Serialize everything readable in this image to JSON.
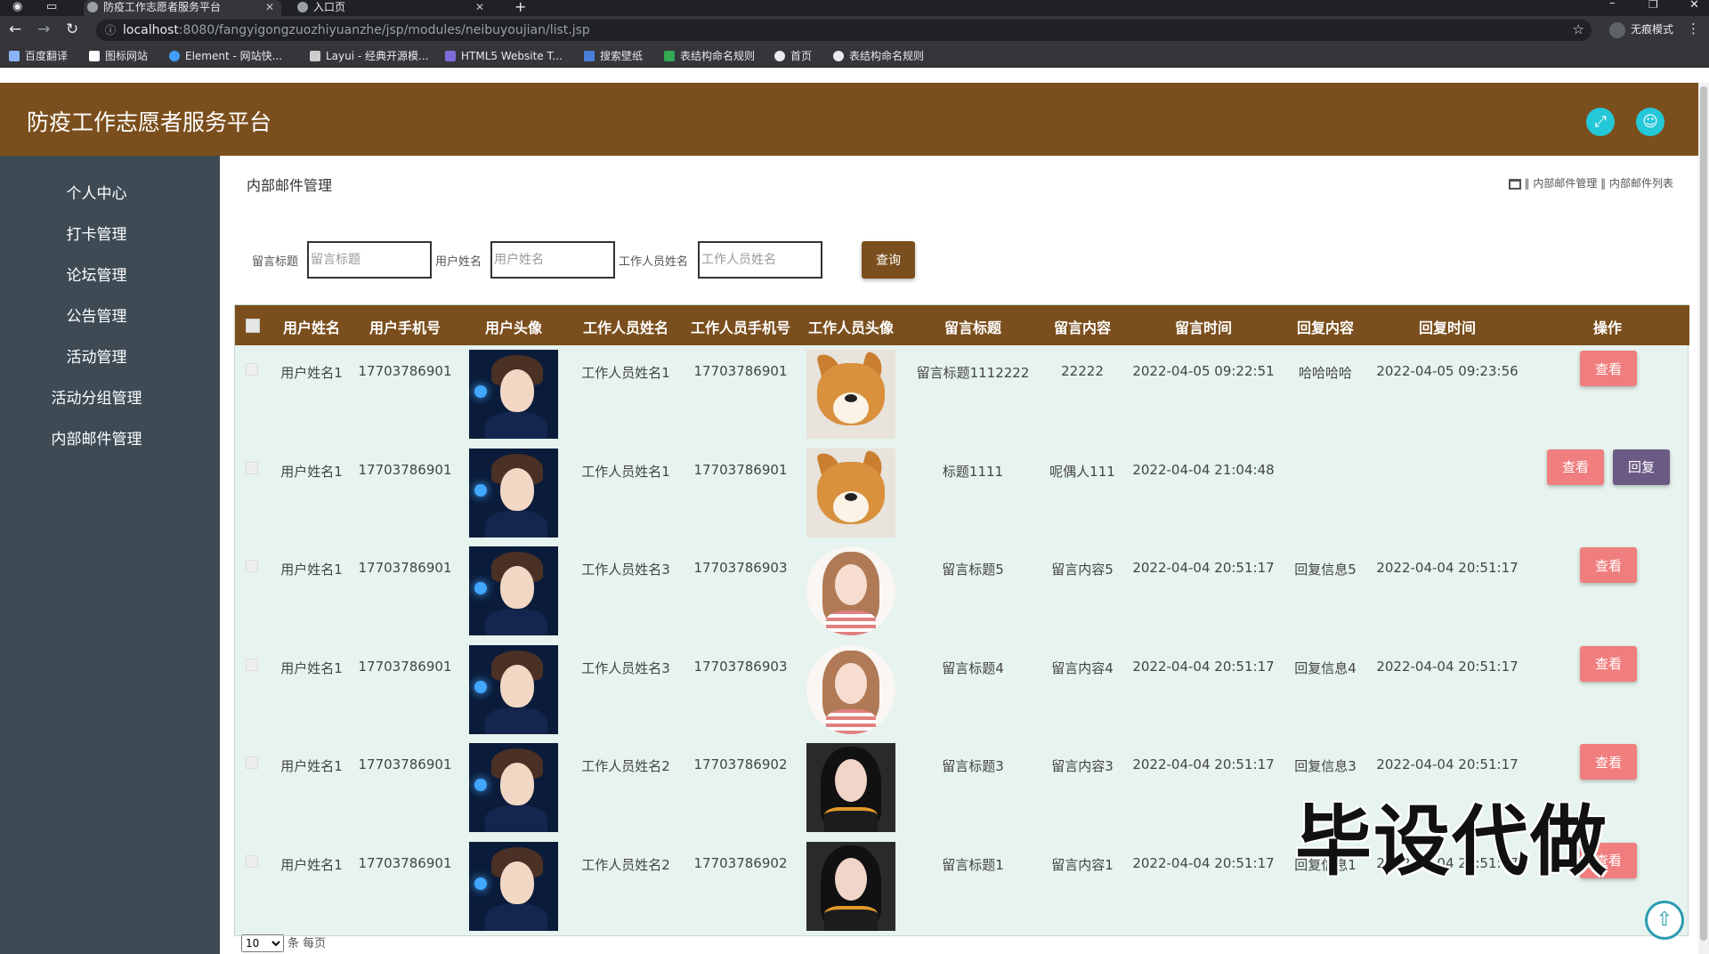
{
  "browser": {
    "tabs": [
      {
        "title": "防疫工作志愿者服务平台",
        "active": true
      },
      {
        "title": "入口页",
        "active": false
      }
    ],
    "url_host": "localhost",
    "url_path": ":8080/fangyigongzuozhiyuanzhe/jsp/modules/neibuyoujian/list.jsp",
    "incognito_label": "无痕模式",
    "bookmarks": [
      "百度翻译",
      "图标网站",
      "Element - 网站快...",
      "Layui - 经典开源模...",
      "HTML5 Website T...",
      "搜索壁纸",
      "表结构命名规则",
      "首页",
      "表结构命名规则"
    ]
  },
  "header": {
    "title": "防疫工作志愿者服务平台"
  },
  "sidebar": {
    "items": [
      "个人中心",
      "打卡管理",
      "论坛管理",
      "公告管理",
      "活动管理",
      "活动分组管理",
      "内部邮件管理"
    ]
  },
  "page": {
    "title": "内部邮件管理",
    "breadcrumb": "‖ 内部邮件管理 ‖ 内部邮件列表"
  },
  "search": {
    "fields": [
      {
        "label": "留言标题",
        "placeholder": "留言标题"
      },
      {
        "label": "用户姓名",
        "placeholder": "用户姓名"
      },
      {
        "label": "工作人员姓名",
        "placeholder": "工作人员姓名"
      }
    ],
    "button": "查询"
  },
  "table": {
    "columns": [
      "用户姓名",
      "用户手机号",
      "用户头像",
      "工作人员姓名",
      "工作人员手机号",
      "工作人员头像",
      "留言标题",
      "留言内容",
      "留言时间",
      "回复内容",
      "回复时间",
      "操作"
    ],
    "rows": [
      {
        "user_name": "用户姓名1",
        "user_phone": "17703786901",
        "staff_name": "工作人员姓名1",
        "staff_phone": "17703786901",
        "staff_avatar": "dog",
        "title": "留言标题1112222",
        "content": "22222",
        "time": "2022-04-05 09:22:51",
        "reply": "哈哈哈哈",
        "reply_time": "2022-04-05 09:23:56",
        "view": "查看"
      },
      {
        "user_name": "用户姓名1",
        "user_phone": "17703786901",
        "staff_name": "工作人员姓名1",
        "staff_phone": "17703786901",
        "staff_avatar": "dog",
        "title": "标题1111",
        "content": "呢偶人111",
        "time": "2022-04-04 21:04:48",
        "reply": "",
        "reply_time": "",
        "view": "查看",
        "reply_btn": "回复"
      },
      {
        "user_name": "用户姓名1",
        "user_phone": "17703786901",
        "staff_name": "工作人员姓名3",
        "staff_phone": "17703786903",
        "staff_avatar": "girl",
        "title": "留言标题5",
        "content": "留言内容5",
        "time": "2022-04-04 20:51:17",
        "reply": "回复信息5",
        "reply_time": "2022-04-04 20:51:17",
        "view": "查看"
      },
      {
        "user_name": "用户姓名1",
        "user_phone": "17703786901",
        "staff_name": "工作人员姓名3",
        "staff_phone": "17703786903",
        "staff_avatar": "girl",
        "title": "留言标题4",
        "content": "留言内容4",
        "time": "2022-04-04 20:51:17",
        "reply": "回复信息4",
        "reply_time": "2022-04-04 20:51:17",
        "view": "查看"
      },
      {
        "user_name": "用户姓名1",
        "user_phone": "17703786901",
        "staff_name": "工作人员姓名2",
        "staff_phone": "17703786902",
        "staff_avatar": "woman",
        "title": "留言标题3",
        "content": "留言内容3",
        "time": "2022-04-04 20:51:17",
        "reply": "回复信息3",
        "reply_time": "2022-04-04 20:51:17",
        "view": "查看"
      },
      {
        "user_name": "用户姓名1",
        "user_phone": "17703786901",
        "staff_name": "工作人员姓名2",
        "staff_phone": "17703786902",
        "staff_avatar": "woman",
        "title": "留言标题1",
        "content": "留言内容1",
        "time": "2022-04-04 20:51:17",
        "reply": "回复信息1",
        "reply_time": "2022-04-04 20:51:17",
        "view": "查看"
      }
    ]
  },
  "pager": {
    "page_size": "10",
    "suffix": "条 每页"
  },
  "watermark": "毕设代做",
  "colors": {
    "brand": "#7b4f1d",
    "sidebar": "#3e4b55",
    "view_button": "#f07e7e",
    "reply_button": "#6b5a84",
    "header_icon": "#24c8d8"
  }
}
